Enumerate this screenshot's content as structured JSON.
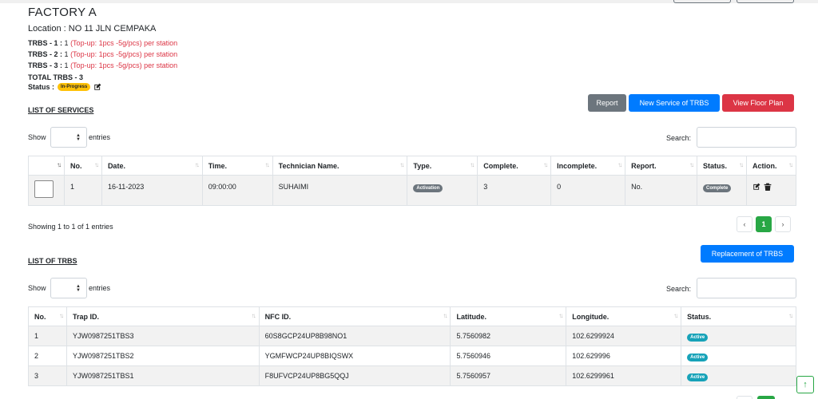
{
  "factory": {
    "title": "FACTORY A",
    "location": "Location : NO 11 JLN CEMPAKA",
    "trbs": [
      {
        "label": "TRBS - 1 :",
        "value": "1",
        "note": "(Top-up: 1pcs -5g/pcs) per station"
      },
      {
        "label": "TRBS - 2 :",
        "value": "1",
        "note": "(Top-up: 1pcs -5g/pcs) per station"
      },
      {
        "label": "TRBS - 3 :",
        "value": "1",
        "note": "(Top-up: 1pcs -5g/pcs) per station"
      }
    ],
    "total": "TOTAL TRBS - 3",
    "status_label": "Status :",
    "status_badge": "In-Progress"
  },
  "services": {
    "section_title": "LIST OF SERVICES",
    "buttons": {
      "report": "Report",
      "new_service": "New Service of TRBS",
      "floor_plan": "View Floor Plan"
    },
    "show_label": "Show",
    "entries_label": "entries",
    "search_label": "Search:",
    "columns": [
      "No.",
      "Date.",
      "Time.",
      "Technician Name.",
      "Type.",
      "Complete.",
      "Incomplete.",
      "Report.",
      "Status.",
      "Action."
    ],
    "rows": [
      {
        "no": "1",
        "date": "16-11-2023",
        "time": "09:00:00",
        "technician": "SUHAIMI",
        "type": "Activation",
        "complete": "3",
        "incomplete": "0",
        "report": "No.",
        "status": "Complete"
      }
    ],
    "showing": "Showing 1 to 1 of 1 entries",
    "pager": {
      "prev": "‹",
      "current": "1",
      "next": "›"
    }
  },
  "trbs_list": {
    "section_title": "LIST OF TRBS",
    "buttons": {
      "replacement": "Replacement of TRBS"
    },
    "show_label": "Show",
    "entries_label": "entries",
    "search_label": "Search:",
    "columns": [
      "No.",
      "Trap ID.",
      "NFC ID.",
      "Latitude.",
      "Longitude.",
      "Status."
    ],
    "rows": [
      {
        "no": "1",
        "trap_id": "YJW0987251TBS3",
        "nfc_id": "60S8GCP24UP8B98NO1",
        "lat": "5.7560982",
        "lng": "102.6299924",
        "status": "Active"
      },
      {
        "no": "2",
        "trap_id": "YJW0987251TBS2",
        "nfc_id": "YGMFWCP24UP8BIQSWX",
        "lat": "5.7560946",
        "lng": "102.629996",
        "status": "Active"
      },
      {
        "no": "3",
        "trap_id": "YJW0987251TBS1",
        "nfc_id": "F8UFVCP24UP8BG5QQJ",
        "lat": "5.7560957",
        "lng": "102.6299961",
        "status": "Active"
      }
    ]
  },
  "colors": {
    "primary": "#007bff",
    "danger": "#dc3545",
    "secondary": "#6c757d",
    "success": "#28a745",
    "warning": "#ffc107",
    "info": "#17a2b8"
  }
}
